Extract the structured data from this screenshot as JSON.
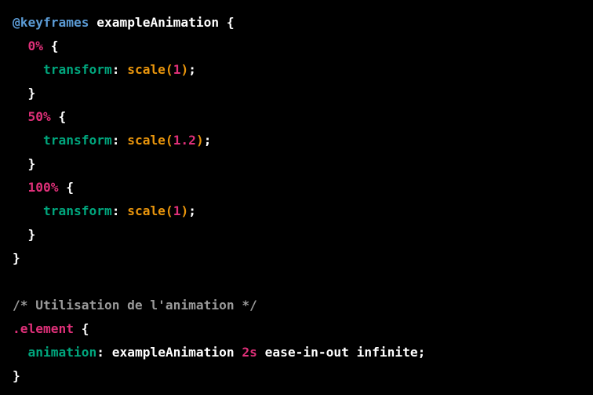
{
  "code": {
    "keyframes_rule": "@keyframes",
    "animation_name": "exampleAnimation",
    "open_brace": "{",
    "close_brace": "}",
    "colon": ":",
    "semicolon": ";",
    "property": "transform",
    "function": "scale(",
    "function_close": ")",
    "frames": [
      {
        "selector": "0%",
        "value": "1"
      },
      {
        "selector": "50%",
        "value": "1.2"
      },
      {
        "selector": "100%",
        "value": "1"
      }
    ],
    "comment": "/* Utilisation de l'animation */",
    "element_selector": ".element",
    "animation_property": "animation",
    "animation_value_name": "exampleAnimation",
    "animation_duration": "2s",
    "animation_rest": "ease-in-out infinite"
  },
  "colors": {
    "background": "#000000",
    "at_rule": "#5b9bd5",
    "selector": "#df3079",
    "property": "#00a67d",
    "function": "#e9950c",
    "number": "#df3079",
    "comment": "#9a9a9a",
    "text": "#ffffff"
  }
}
